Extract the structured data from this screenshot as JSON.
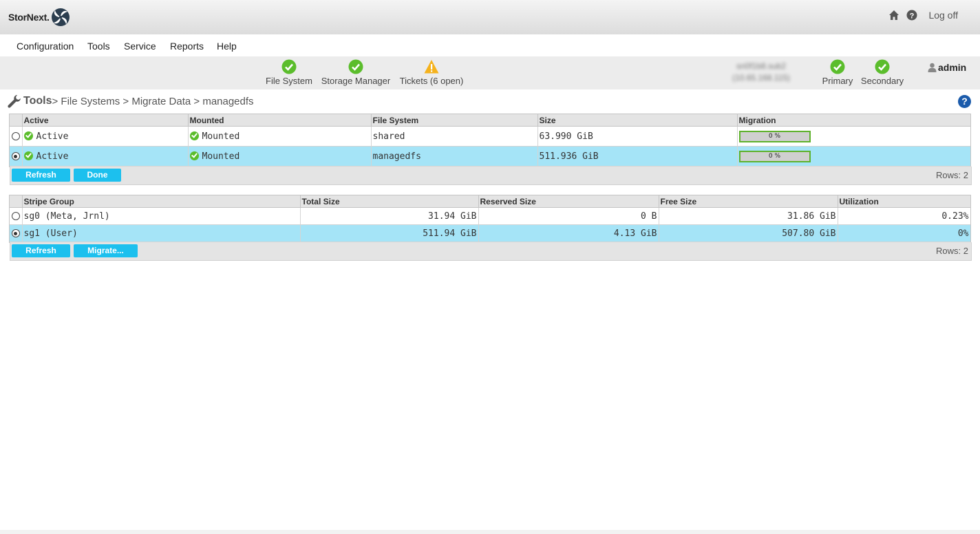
{
  "app": {
    "logo_text": "StorNext.",
    "logoff_label": "Log off"
  },
  "menu": {
    "items": [
      "Configuration",
      "Tools",
      "Service",
      "Reports",
      "Help"
    ]
  },
  "status": {
    "items": [
      {
        "label": "File System",
        "state": "ok"
      },
      {
        "label": "Storage Manager",
        "state": "ok"
      },
      {
        "label": "Tickets (6 open)",
        "state": "warning"
      }
    ],
    "nodes": [
      {
        "label": "Primary",
        "state": "ok"
      },
      {
        "label": "Secondary",
        "state": "ok"
      }
    ],
    "user": "admin"
  },
  "breadcrumb": {
    "root": "Tools",
    "path": "> File Systems > Migrate Data > managedfs"
  },
  "fs_table": {
    "headers": [
      "Active",
      "Mounted",
      "File System",
      "Size",
      "Migration"
    ],
    "rows": [
      {
        "active": "Active",
        "mounted": "Mounted",
        "fs": "shared",
        "size": "63.990 GiB",
        "migration": "0 %",
        "selected": false
      },
      {
        "active": "Active",
        "mounted": "Mounted",
        "fs": "managedfs",
        "size": "511.936 GiB",
        "migration": "0 %",
        "selected": true
      }
    ],
    "buttons": {
      "refresh": "Refresh",
      "done": "Done"
    },
    "rows_label": "Rows: 2"
  },
  "sg_table": {
    "headers": [
      "Stripe Group",
      "Total Size",
      "Reserved Size",
      "Free Size",
      "Utilization"
    ],
    "rows": [
      {
        "group": "sg0 (Meta, Jrnl)",
        "total": "31.94 GiB",
        "reserved": "0 B",
        "free": "31.86 GiB",
        "util": "0.23%",
        "selected": false
      },
      {
        "group": "sg1 (User)",
        "total": "511.94 GiB",
        "reserved": "4.13 GiB",
        "free": "507.80 GiB",
        "util": "0%",
        "selected": true
      }
    ],
    "buttons": {
      "refresh": "Refresh",
      "migrate": "Migrate..."
    },
    "rows_label": "Rows: 2"
  },
  "colors": {
    "accent": "#1cc0ee",
    "selected_row": "#a5e4f7",
    "ok": "#5bbd2c",
    "warning": "#f5b21c",
    "help": "#1b5bab"
  }
}
